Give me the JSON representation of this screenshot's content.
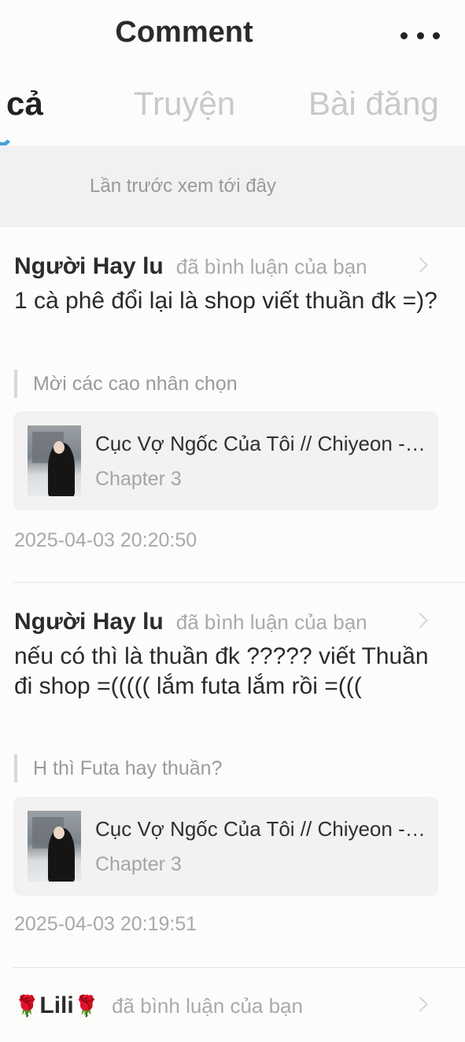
{
  "header": {
    "title": "Comment",
    "more_icon": "more-horizontal-icon"
  },
  "tabs": [
    {
      "label": "cả",
      "active": true
    },
    {
      "label": "Truyện",
      "active": false
    },
    {
      "label": "Bài đăng",
      "active": false
    }
  ],
  "last_seen": "Lần trước xem tới đây",
  "comments": [
    {
      "user": "Người Hay lu",
      "action": "đã bình luận của bạn",
      "text": "1 cà phê đổi lại là shop viết thuần đk =)?",
      "quote": "Mời các cao nhân chọn",
      "story_title": "Cục Vợ Ngốc Của Tôi // Chiyeon - Jiyeon",
      "chapter": "Chapter 3",
      "time": "2025-04-03 20:20:50"
    },
    {
      "user": "Người Hay lu",
      "action": "đã bình luận của bạn",
      "text": "nếu có thì là thuần đk ????? viết Thuần đi shop =((((( lắm futa lắm rồi =(((",
      "quote": "H thì Futa hay thuần?",
      "story_title": "Cục Vợ Ngốc Của Tôi // Chiyeon - Jiyeon",
      "chapter": "Chapter 3",
      "time": "2025-04-03 20:19:51"
    },
    {
      "user": "Lili",
      "user_decoration": "🌹",
      "action": "đã bình luận của bạn"
    }
  ],
  "colors": {
    "accent": "#4aa3e0",
    "background": "#fcfcfb",
    "card": "#f2f2f2",
    "muted": "#a9a9a9"
  }
}
